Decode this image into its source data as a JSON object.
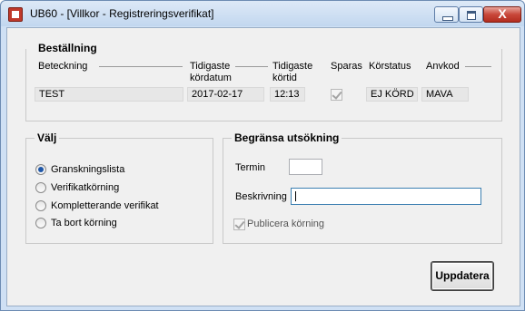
{
  "window": {
    "title": "UB60 - [Villkor - Registreringsverifikat]",
    "controls": [
      "minimize-icon",
      "maximize-icon",
      "close-icon"
    ],
    "close_glyph": "X"
  },
  "order": {
    "group_title": "Beställning",
    "columns": {
      "designation": "Beteckning",
      "earliest_date_line1": "Tidigaste",
      "earliest_date_line2": "kördatum",
      "earliest_time_line1": "Tidigaste",
      "earliest_time_line2": "körtid",
      "saved": "Sparas",
      "run_status": "Körstatus",
      "user_code": "Anvkod"
    },
    "values": {
      "designation": "TEST",
      "earliest_date": "2017-02-17",
      "earliest_time": "12:13",
      "saved_checked": true,
      "run_status": "EJ KÖRD",
      "user_code": "MAVA"
    }
  },
  "choose": {
    "group_title": "Välj",
    "selected": "Granskningslista",
    "options": [
      {
        "label": "Granskningslista",
        "selected": true
      },
      {
        "label": "Verifikatkörning",
        "selected": false
      },
      {
        "label": "Kompletterande verifikat",
        "selected": false
      },
      {
        "label": "Ta bort körning",
        "selected": false
      }
    ]
  },
  "limit": {
    "group_title": "Begränsa utsökning",
    "term_label": "Termin",
    "term_value": "",
    "description_label": "Beskrivning",
    "description_value": "",
    "publish_label": "Publicera körning",
    "publish_checked": true
  },
  "actions": {
    "update_label": "Uppdatera"
  },
  "colors": {
    "titlebar": "#c8dbf1",
    "client": "#f0f0f0",
    "close_button": "#c8473a",
    "radio_selected": "#1f57a8"
  }
}
